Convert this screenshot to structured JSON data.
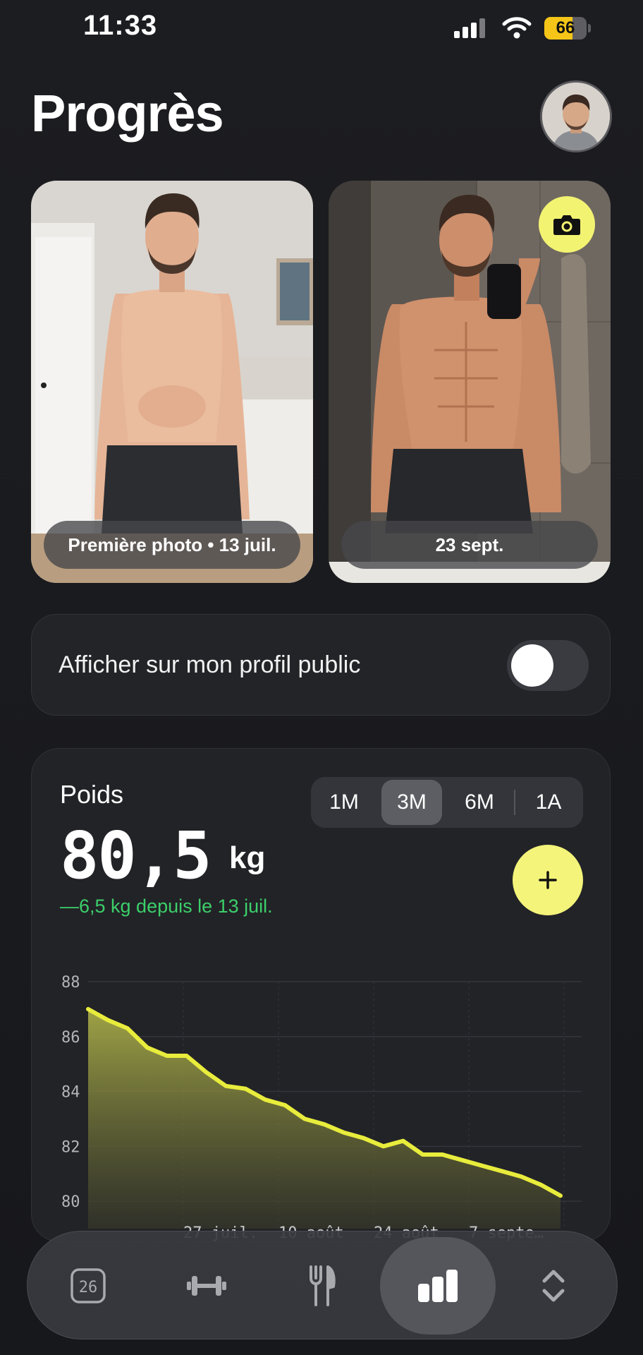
{
  "status_bar": {
    "time": "11:33",
    "battery": "66",
    "battery_level": 0.66,
    "icons": [
      "cellular-signal-icon",
      "wifi-icon",
      "battery-icon"
    ]
  },
  "header": {
    "title": "Progrès",
    "avatar_icon": "profile-avatar"
  },
  "photos": {
    "first_label": "Première photo • 13 juil.",
    "latest_label": "23 sept.",
    "camera_icon": "camera-icon"
  },
  "public_toggle": {
    "label": "Afficher sur mon profil public",
    "on": false
  },
  "weight": {
    "label": "Poids",
    "value": "80,5",
    "unit": "kg",
    "delta": "—6,5 kg depuis le 13 juil.",
    "ranges": [
      "1M",
      "3M",
      "6M",
      "1A"
    ],
    "selected_range": "3M",
    "add_icon": "plus-icon"
  },
  "chart_data": {
    "type": "area",
    "x_tick_labels": [
      "27 juil.",
      "10 août",
      "24 août",
      "7 septe…"
    ],
    "y_tick_labels": [
      "88",
      "86",
      "84",
      "82",
      "80"
    ],
    "ylim": [
      79,
      88
    ],
    "grid": true,
    "series": [
      {
        "x": [
          "13 juil.",
          "17 juil.",
          "20 juil.",
          "22 juil.",
          "24 juil.",
          "28 juil.",
          "31 juil.",
          "3 août",
          "6 août",
          "9 août",
          "12 août",
          "15 août",
          "18 août",
          "21 août",
          "23 août",
          "25 août",
          "26 août",
          "30 août",
          "2 sept.",
          "6 sept.",
          "10 sept.",
          "14 sept.",
          "18 sept.",
          "21 sept.",
          "23 sept."
        ],
        "values": [
          87.0,
          86.6,
          86.3,
          85.6,
          85.3,
          85.3,
          84.7,
          84.2,
          84.1,
          83.7,
          83.5,
          83.0,
          82.8,
          82.5,
          82.3,
          82.0,
          82.2,
          81.7,
          81.7,
          81.5,
          81.3,
          81.1,
          80.9,
          80.6,
          80.2
        ]
      }
    ],
    "line_color": "#e8ec3c"
  },
  "bottom_nav": {
    "items": [
      {
        "icon": "calendar-icon",
        "badge": "26"
      },
      {
        "icon": "dumbbell-icon"
      },
      {
        "icon": "fork-knife-icon"
      },
      {
        "icon": "bar-chart-icon",
        "active": true
      },
      {
        "icon": "chevron-up-down-icon"
      }
    ]
  }
}
